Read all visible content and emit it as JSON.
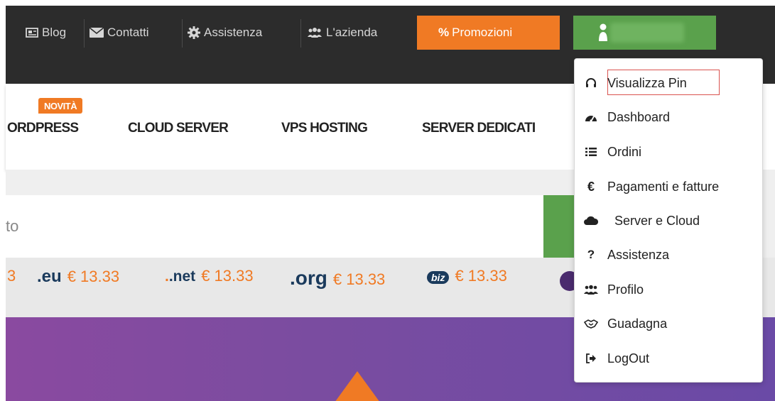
{
  "topbar": {
    "links": [
      {
        "label": "Blog",
        "icon": "newspaper-icon"
      },
      {
        "label": "Contatti",
        "icon": "envelope-icon"
      },
      {
        "label": "Assistenza",
        "icon": "gear-icon"
      },
      {
        "label": "L'azienda",
        "icon": "users-icon"
      }
    ],
    "promo_label": "Promozioni",
    "promo_icon": "%",
    "user_name_hidden": true
  },
  "nav": {
    "badge_new": "NOVITÀ",
    "items": [
      "ORDPRESS",
      "CLOUD SERVER",
      "VPS HOSTING",
      "SERVER DEDICATI"
    ]
  },
  "search": {
    "partial_text": "to"
  },
  "domains": [
    {
      "tld": "",
      "price": "3"
    },
    {
      "tld": ".eu",
      "price": "€ 13.33"
    },
    {
      "tld": ".net",
      "price": "€ 13.33"
    },
    {
      "tld": ".org",
      "price": "€ 13.33"
    },
    {
      "tld": "biz",
      "price": "€ 13.33"
    }
  ],
  "dropdown": {
    "items": [
      {
        "label": "Visualizza Pin",
        "icon": "headset-icon"
      },
      {
        "label": "Dashboard",
        "icon": "dashboard-icon"
      },
      {
        "label": "Ordini",
        "icon": "list-icon"
      },
      {
        "label": "Pagamenti e fatture",
        "icon": "euro-icon"
      },
      {
        "label": "Server e Cloud",
        "icon": "cloud-icon"
      },
      {
        "label": "Assistenza",
        "icon": "question-icon"
      },
      {
        "label": "Profilo",
        "icon": "users-icon"
      },
      {
        "label": "Guadagna",
        "icon": "handshake-icon"
      },
      {
        "label": "LogOut",
        "icon": "logout-icon"
      }
    ]
  },
  "colors": {
    "accent_orange": "#f07a24",
    "accent_green": "#5aa14c",
    "topbar_dark": "#2c2c2c",
    "highlight_red": "#d9534f",
    "hero_purple": "#7a4ca0"
  }
}
